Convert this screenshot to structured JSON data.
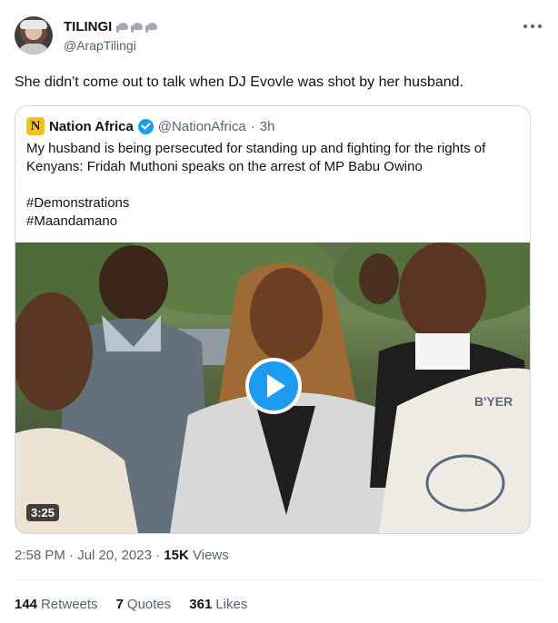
{
  "author": {
    "display_name": "TILINGI",
    "handle": "@ArapTilingi",
    "badge_icons": [
      "elephant-icon",
      "elephant-icon",
      "elephant-icon"
    ]
  },
  "tweet": {
    "text": "She didn't come out to talk when DJ Evovle was shot by her husband."
  },
  "quoted": {
    "name": "Nation Africa",
    "handle": "@NationAfrica",
    "separator": "·",
    "time": "3h",
    "logo_letter": "N",
    "text": "My husband is being persecuted for standing up and fighting for the rights of Kenyans: Fridah Muthoni speaks on the arrest of MP Babu Owino",
    "hashtags": [
      "#Demonstrations",
      "#Maandamano"
    ],
    "video": {
      "duration": "3:25",
      "shirt_text": "B'YER"
    }
  },
  "meta": {
    "time": "2:58 PM",
    "separator": "·",
    "date": "Jul 20, 2023",
    "views_count": "15K",
    "views_label": "Views"
  },
  "stats": [
    {
      "count": "144",
      "label": "Retweets"
    },
    {
      "count": "7",
      "label": "Quotes"
    },
    {
      "count": "361",
      "label": "Likes"
    }
  ],
  "colors": {
    "accent": "#1d9bf0",
    "text": "#0f1419",
    "muted": "#536471",
    "border": "#cfd9de",
    "logo": "#f3c21b"
  }
}
